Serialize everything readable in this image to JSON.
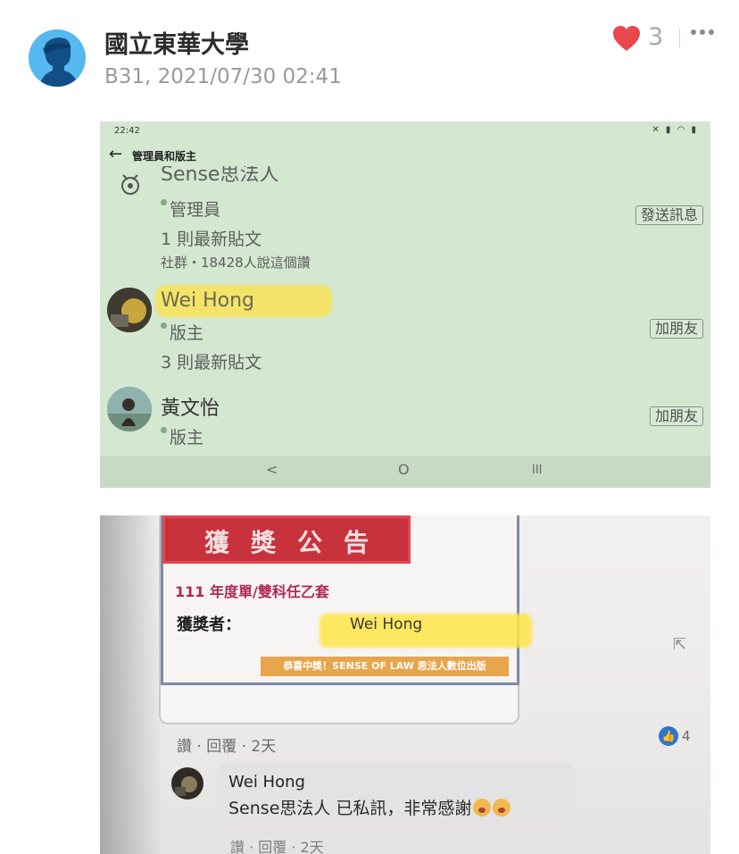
{
  "post": {
    "author": "國立東華大學",
    "meta": "B31, 2021/07/30 02:41",
    "like_count": "3",
    "accent_color": "#e8474e"
  },
  "screenshot_admins": {
    "status_time": "22:42",
    "toolbar_title": "管理員和版主",
    "page_name": "Sense思法人",
    "page_role": "管理員",
    "page_posts": "1 則最新貼文",
    "page_likes": "社群・18428人說這個讚",
    "send_message": "發送訊息",
    "member1_name": "Wei Hong",
    "member1_role": "版主",
    "member1_posts": "3 則最新貼文",
    "add_friend": "加朋友",
    "member2_name": "黃文怡",
    "member2_role": "版主",
    "nav_back": "<",
    "nav_home": "O",
    "nav_recent": "III"
  },
  "screenshot_award": {
    "banner": "獲獎公告",
    "award_year": "111 年度單/雙科任乙套",
    "winner_label": "獲獎者：",
    "winner_name": "Wei Hong",
    "congrats": "恭喜中獎！SENSE OF LAW 思法人數位出版",
    "actions": "讚 · 回覆 · 2天",
    "like_badge_count": "4",
    "comment_author": "Wei Hong",
    "comment_text": "Sense思法人 已私訊，非常感謝",
    "comment_actions": "讚 · 回覆 · 2天"
  }
}
